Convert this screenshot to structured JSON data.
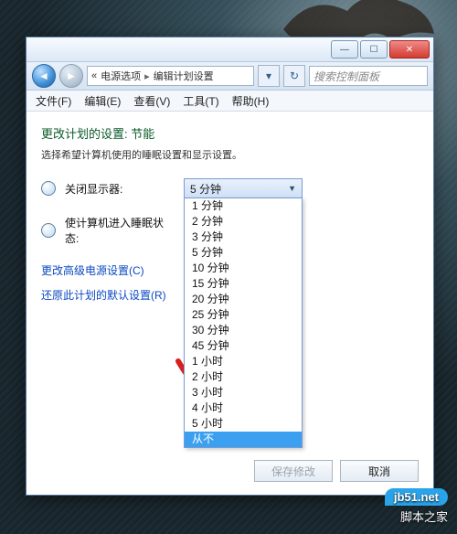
{
  "window": {
    "breadcrumb_prefix": "«",
    "breadcrumb1": "电源选项",
    "breadcrumb2": "编辑计划设置",
    "search_placeholder": "搜索控制面板"
  },
  "menu": {
    "file": "文件(F)",
    "edit": "编辑(E)",
    "view": "查看(V)",
    "tools": "工具(T)",
    "help": "帮助(H)"
  },
  "page": {
    "title": "更改计划的设置: 节能",
    "desc": "选择希望计算机使用的睡眠设置和显示设置。"
  },
  "rows": {
    "display_off": {
      "icon": "monitor-icon",
      "label": "关闭显示器:",
      "selected": "5 分钟"
    },
    "sleep": {
      "icon": "moon-icon",
      "label": "使计算机进入睡眠状态:"
    }
  },
  "dropdown_options": [
    "1 分钟",
    "2 分钟",
    "3 分钟",
    "5 分钟",
    "10 分钟",
    "15 分钟",
    "20 分钟",
    "25 分钟",
    "30 分钟",
    "45 分钟",
    "1 小时",
    "2 小时",
    "3 小时",
    "4 小时",
    "5 小时",
    "从不"
  ],
  "dropdown_highlight": "从不",
  "links": {
    "advanced": "更改高级电源设置(C)",
    "restore": "还原此计划的默认设置(R)"
  },
  "buttons": {
    "save": "保存修改",
    "cancel": "取消"
  },
  "watermark": {
    "brand": "jb51.net",
    "text": "脚本之家"
  }
}
